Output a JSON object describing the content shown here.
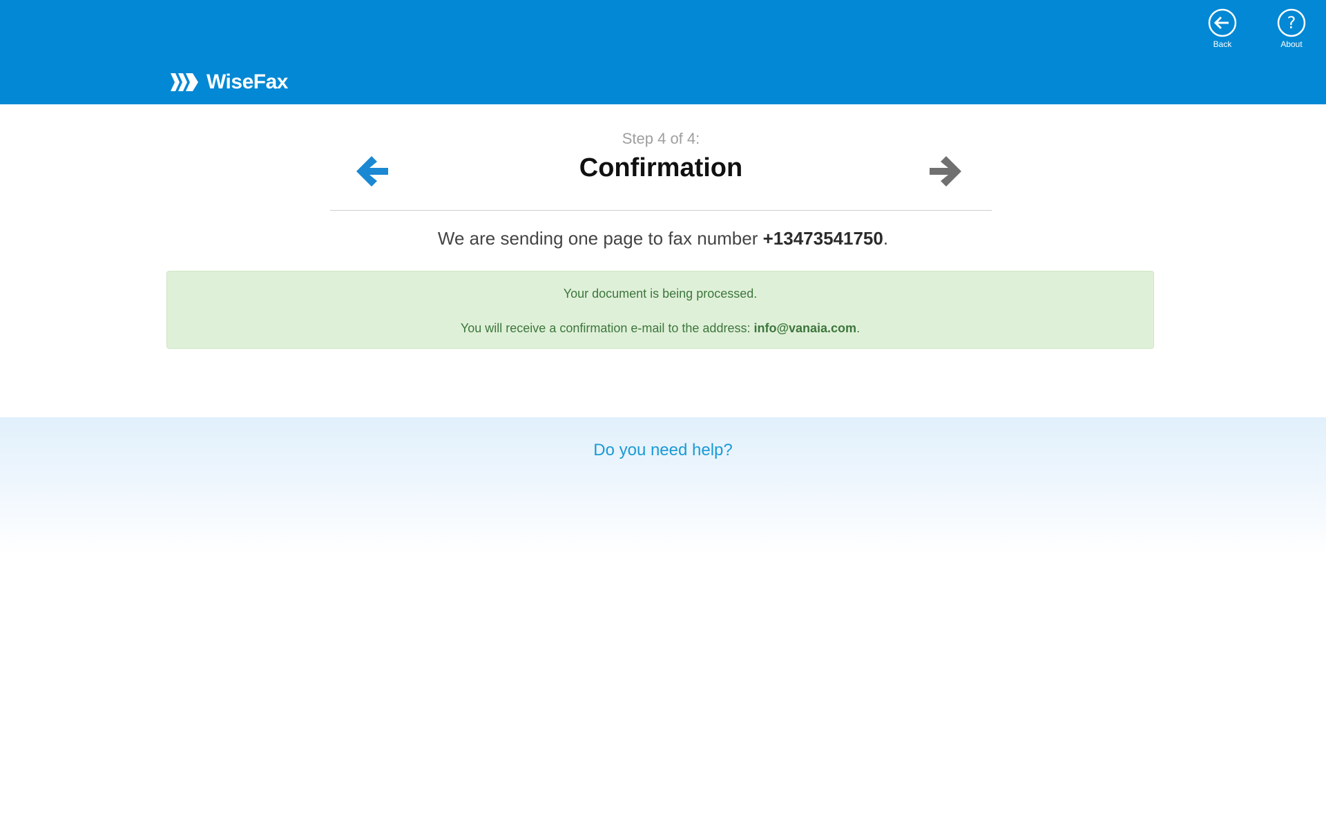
{
  "header": {
    "brand": "WiseFax",
    "back_label": "Back",
    "about_label": "About",
    "colors": {
      "bar": "#0288d4",
      "text": "#ffffff"
    }
  },
  "stepper": {
    "step_label": "Step 4 of 4:",
    "title": "Confirmation",
    "prev_icon": "arrow-left-icon",
    "next_icon": "arrow-right-icon",
    "colors": {
      "prev": "#1a88d2",
      "next": "#707070"
    }
  },
  "summary": {
    "prefix": "We are sending one page to fax number ",
    "fax_number": "+13473541750",
    "suffix": "."
  },
  "alert": {
    "line1": "Your document is being processed.",
    "line2_prefix": "You will receive a confirmation e-mail to the address: ",
    "email": "info@vanaia.com",
    "line2_suffix": ".",
    "colors": {
      "background": "#dff0d8",
      "text": "#3c763d"
    }
  },
  "help": {
    "link_text": "Do you need help?",
    "color": "#1a9ad6"
  }
}
